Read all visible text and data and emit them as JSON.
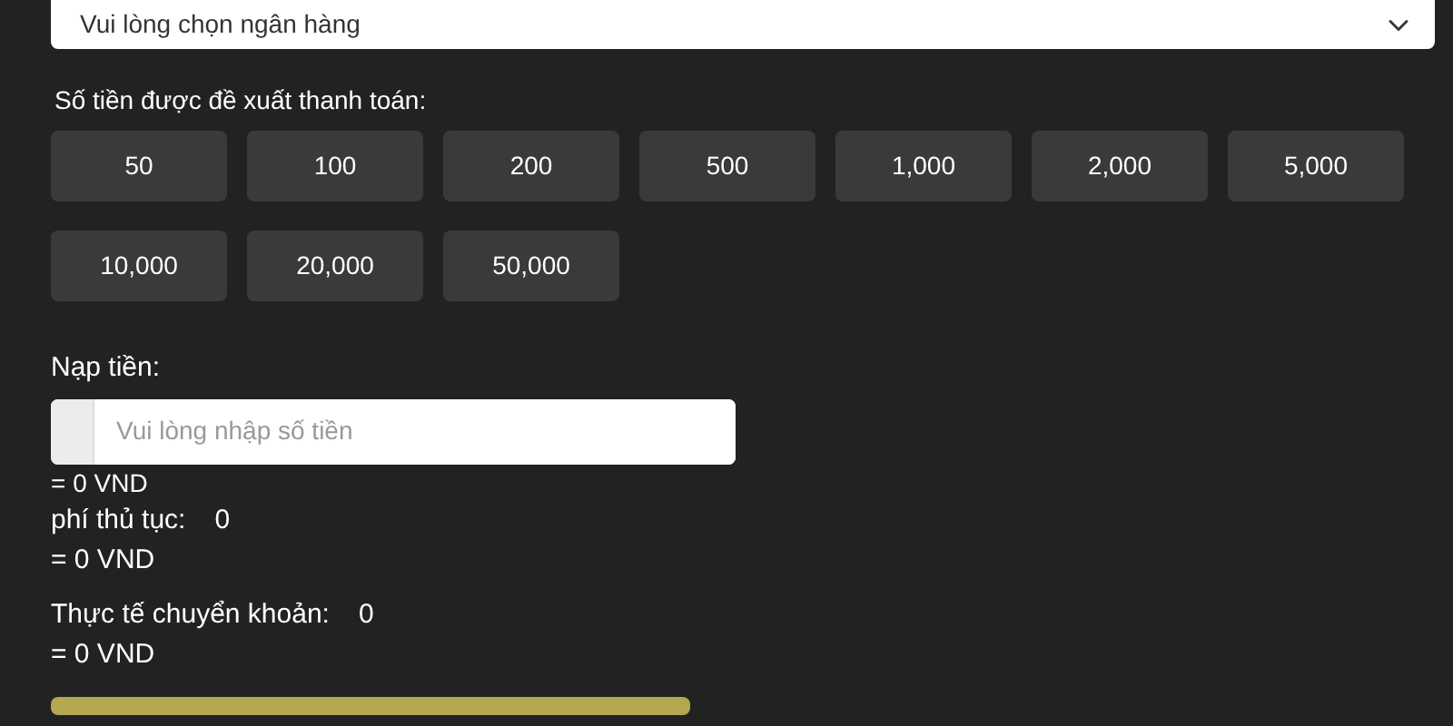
{
  "bank_select": {
    "placeholder": "Vui lòng chọn ngân hàng"
  },
  "amount_label": "Số tiền được đề xuất thanh toán:",
  "amount_options": [
    "50",
    "100",
    "200",
    "500",
    "1,000",
    "2,000",
    "5,000",
    "10,000",
    "20,000",
    "50,000"
  ],
  "deposit_label": "Nạp tiền:",
  "deposit_input": {
    "placeholder": "Vui lòng nhập số tiền"
  },
  "deposit_converted": "= 0 VND",
  "fee": {
    "label": "phí thủ tục:",
    "value": "0",
    "converted": "= 0 VND"
  },
  "actual": {
    "label": "Thực tế chuyển khoản:",
    "value": "0",
    "converted": "= 0 VND"
  }
}
